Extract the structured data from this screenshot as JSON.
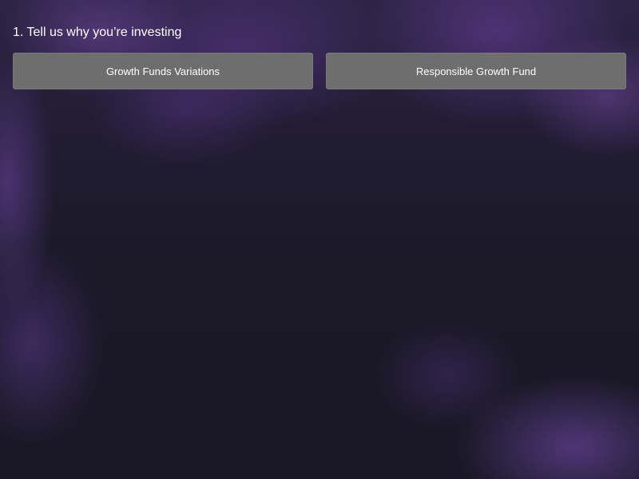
{
  "question": {
    "text": "1. Tell us why you’re investing"
  },
  "options": [
    {
      "label": "Growth Funds Variations"
    },
    {
      "label": "Responsible Growth Fund"
    }
  ],
  "colors": {
    "button_bg": "#6e6e6e",
    "text": "#ffffff",
    "background": "#1c1a2a"
  }
}
